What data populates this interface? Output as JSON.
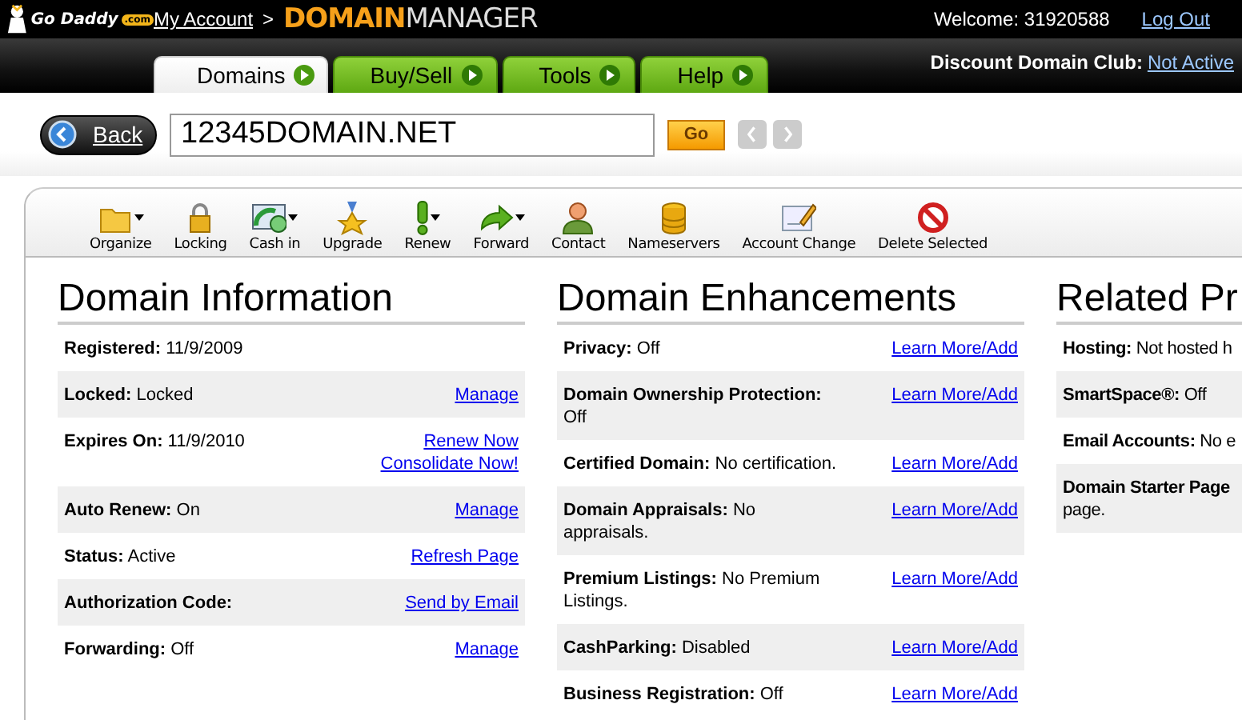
{
  "header": {
    "logo": "Go Daddy",
    "logo_suffix": ".com",
    "my_account": "My Account",
    "separator": ">",
    "app_title": {
      "accent": "DOMAIN",
      "rest": "MANAGER"
    },
    "welcome": "Welcome: 31920588",
    "logout": "Log Out"
  },
  "tabs": [
    {
      "label": "Domains",
      "selected": true
    },
    {
      "label": "Buy/Sell",
      "selected": false
    },
    {
      "label": "Tools",
      "selected": false
    },
    {
      "label": "Help",
      "selected": false
    }
  ],
  "club": {
    "label": "Discount Domain Club:",
    "link": "Not Active"
  },
  "search": {
    "back": "Back",
    "value": "12345DOMAIN.NET",
    "go": "Go",
    "prev_disabled": true,
    "next_disabled": true
  },
  "toolbar": [
    {
      "label": "Organize",
      "kind": "folder",
      "menu": true
    },
    {
      "label": "Locking",
      "kind": "lock",
      "menu": false
    },
    {
      "label": "Cash in",
      "kind": "cash",
      "menu": true
    },
    {
      "label": "Upgrade",
      "kind": "medal",
      "menu": false
    },
    {
      "label": "Renew",
      "kind": "exclaim",
      "menu": true
    },
    {
      "label": "Forward",
      "kind": "arrow",
      "menu": true
    },
    {
      "label": "Contact",
      "kind": "person",
      "menu": false
    },
    {
      "label": "Nameservers",
      "kind": "database",
      "menu": false
    },
    {
      "label": "Account Change",
      "kind": "form",
      "menu": false
    },
    {
      "label": "Delete Selected",
      "kind": "nosign",
      "menu": false
    }
  ],
  "sections": [
    {
      "title": "Domain Information",
      "rows": [
        {
          "label": "Registered:",
          "value": "11/9/2009",
          "links": []
        },
        {
          "label": "Locked:",
          "value": "Locked",
          "links": [
            "Manage"
          ]
        },
        {
          "label": "Expires On:",
          "value": "11/9/2010",
          "links": [
            "Renew Now",
            "Consolidate Now!"
          ]
        },
        {
          "label": "Auto Renew:",
          "value": "On",
          "links": [
            "Manage"
          ]
        },
        {
          "label": "Status:",
          "value": "Active",
          "links": [
            "Refresh Page"
          ]
        },
        {
          "label": "Authorization Code:",
          "value": "",
          "links": [
            "Send by Email"
          ]
        },
        {
          "label": "Forwarding:",
          "value": "Off",
          "links": [
            "Manage"
          ]
        }
      ]
    },
    {
      "title": "Domain Enhancements",
      "rows": [
        {
          "label": "Privacy:",
          "value": "Off",
          "links": [
            "Learn More/Add"
          ]
        },
        {
          "label": "Domain Ownership Protection:",
          "value": "Off",
          "links": [
            "Learn More/Add"
          ]
        },
        {
          "label": "Certified Domain:",
          "value": "No certification.",
          "links": [
            "Learn More/Add"
          ]
        },
        {
          "label": "Domain Appraisals:",
          "value": "No appraisals.",
          "links": [
            "Learn More/Add"
          ]
        },
        {
          "label": "Premium Listings:",
          "value": "No Premium Listings.",
          "links": [
            "Learn More/Add"
          ]
        },
        {
          "label": "CashParking:",
          "value": "Disabled",
          "links": [
            "Learn More/Add"
          ]
        },
        {
          "label": "Business Registration:",
          "value": "Off",
          "links": [
            "Learn More/Add"
          ]
        }
      ]
    },
    {
      "title": "Related Pr",
      "rows": [
        {
          "label": "Hosting:",
          "value": "Not hosted h",
          "links": []
        },
        {
          "label": "SmartSpace®:",
          "value": "Off",
          "links": []
        },
        {
          "label": "Email Accounts:",
          "value": "No e",
          "links": []
        },
        {
          "label": "Domain Starter Page",
          "value": "page.",
          "links": []
        }
      ]
    }
  ]
}
